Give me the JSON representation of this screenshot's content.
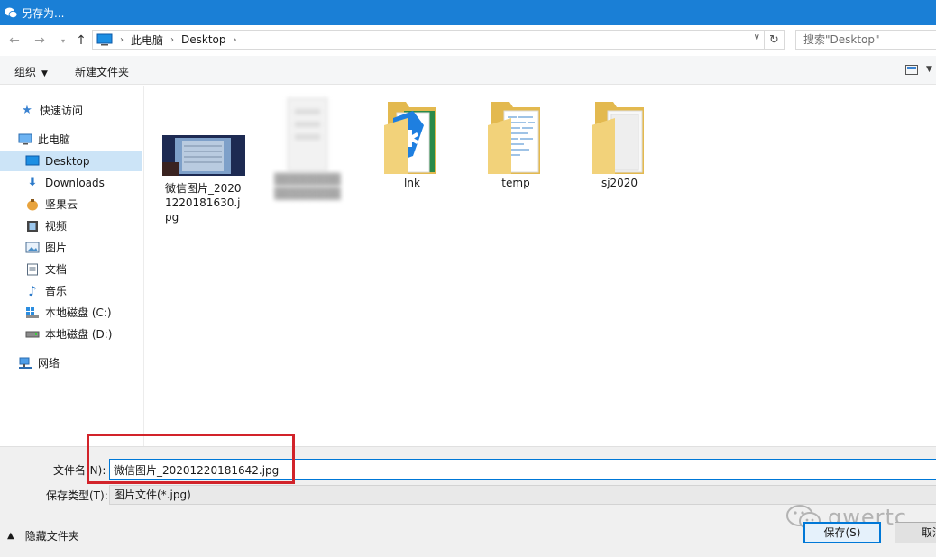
{
  "window": {
    "title": "另存为..."
  },
  "address": {
    "crumbs": [
      "此电脑",
      "Desktop"
    ],
    "search_placeholder": "搜索\"Desktop\""
  },
  "toolbar": {
    "organize": "组织",
    "new_folder": "新建文件夹"
  },
  "nav": {
    "items": [
      {
        "label": "快速访问"
      },
      {
        "label": "此电脑"
      },
      {
        "label": "Desktop"
      },
      {
        "label": "Downloads"
      },
      {
        "label": "坚果云"
      },
      {
        "label": "视频"
      },
      {
        "label": "图片"
      },
      {
        "label": "文档"
      },
      {
        "label": "音乐"
      },
      {
        "label": "本地磁盘 (C:)"
      },
      {
        "label": "本地磁盘 (D:)"
      },
      {
        "label": "网络"
      }
    ]
  },
  "files": [
    {
      "label": "微信图片_20201220181630.jpg"
    },
    {
      "label": "lnk"
    },
    {
      "label": "temp"
    },
    {
      "label": "sj2020"
    }
  ],
  "form": {
    "filename_label": "文件名(N):",
    "filename_value": "微信图片_20201220181642.jpg",
    "filetype_label": "保存类型(T):",
    "filetype_value": "图片文件(*.jpg)"
  },
  "footer": {
    "hide_folders": "隐藏文件夹",
    "save": "保存(S)",
    "cancel": "取消"
  },
  "watermark": {
    "text": "qwertc"
  },
  "colors": {
    "titlebar": "#1a7fd6",
    "selection": "#cce4f7",
    "highlight_box": "#d2232a"
  }
}
